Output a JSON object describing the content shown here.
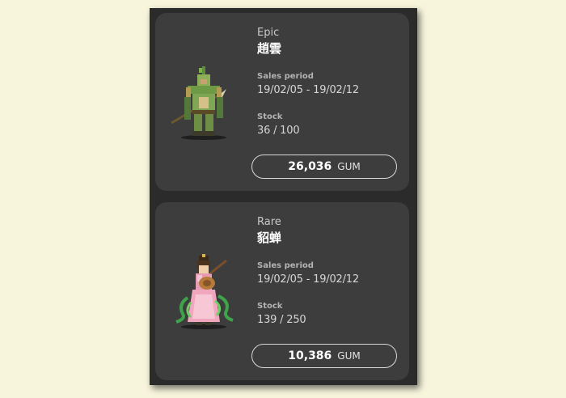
{
  "items": [
    {
      "rarity": "Epic",
      "name": "趙雲",
      "sales_period_label": "Sales period",
      "sales_period": "19/02/05 - 19/02/12",
      "stock_label": "Stock",
      "stock": "36 / 100",
      "price": "26,036",
      "currency": "GUM",
      "sprite": "armored-warrior-sprite"
    },
    {
      "rarity": "Rare",
      "name": "貂蝉",
      "sales_period_label": "Sales period",
      "sales_period": "19/02/05 - 19/02/12",
      "stock_label": "Stock",
      "stock": "139 / 250",
      "price": "10,386",
      "currency": "GUM",
      "sprite": "lute-dancer-sprite"
    }
  ],
  "colors": {
    "page_background": "#f8f5dd",
    "panel_background": "#2b2b2b",
    "card_background": "#3d3d3d"
  }
}
